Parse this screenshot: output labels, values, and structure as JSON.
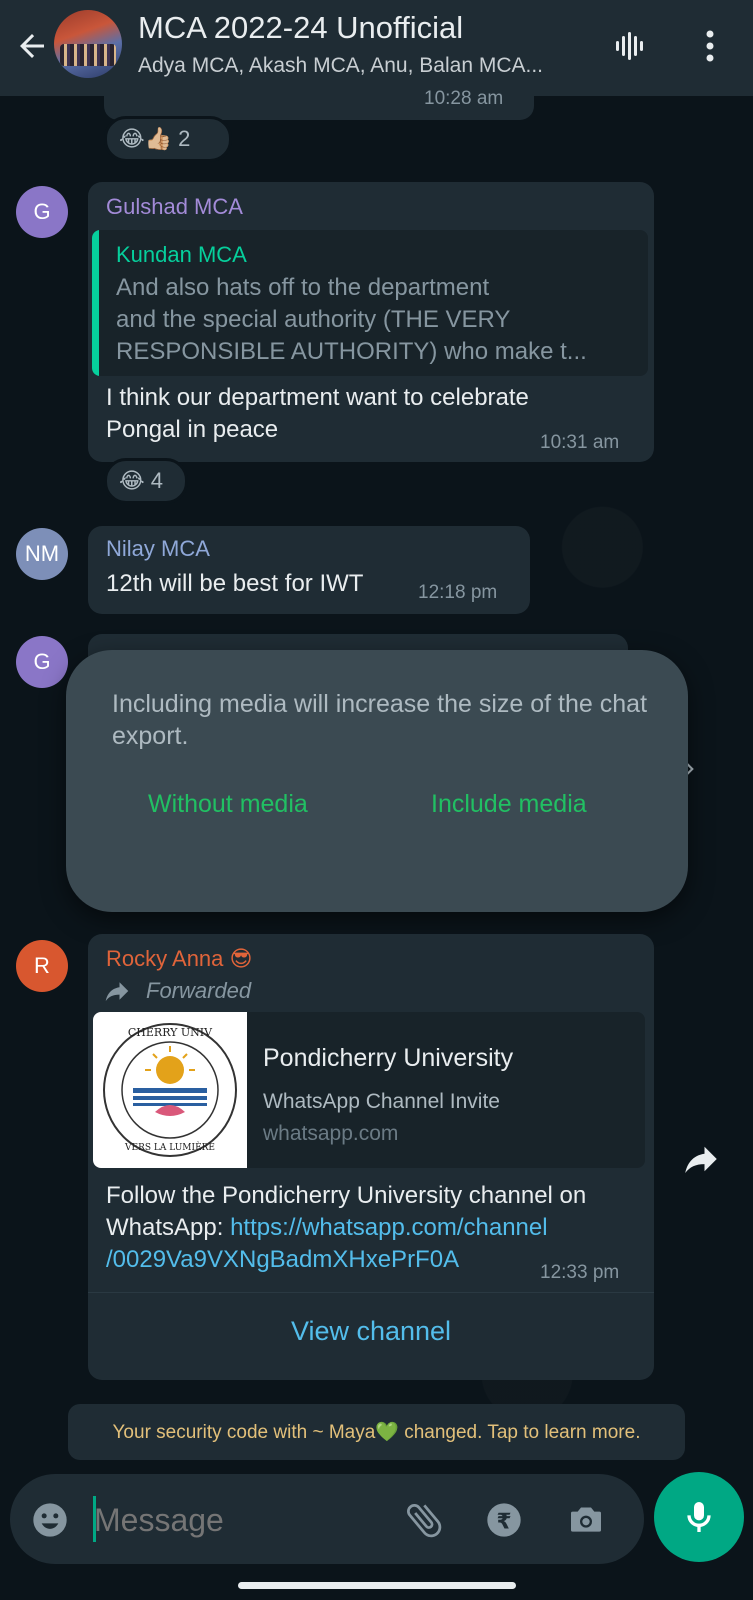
{
  "header": {
    "title": "MCA 2022-24 Unofficial",
    "subtitle": "Adya MCA, Akash MCA, Anu, Balan MCA..."
  },
  "messages": [
    {
      "time_partial": "10:28 am",
      "reaction_emojis": "😂👍🏼",
      "reaction_count": "2"
    },
    {
      "avatar_initial": "G",
      "sender": "Gulshad MCA",
      "sender_color": "#a38bd8",
      "quote_sender": "Kundan MCA",
      "quote_text_line1": "And also hats off to the department",
      "quote_text_line2": "and the special authority (THE VERY",
      "quote_text_line3": "RESPONSIBLE AUTHORITY) who make t...",
      "text_line1": "I think our department want to celebrate",
      "text_line2": "Pongal in peace",
      "time": "10:31 am",
      "reaction_emojis": "😂",
      "reaction_count": "4"
    },
    {
      "avatar_initial": "NM",
      "sender": "Nilay MCA",
      "sender_color": "#8fa8d8",
      "text": "12th will be best for IWT",
      "time": "12:18 pm"
    },
    {
      "avatar_initial": "G"
    },
    {
      "avatar_initial": "R",
      "sender": "Rocky Anna 😎",
      "sender_color": "#e0643a",
      "forwarded": "Forwarded",
      "preview_title": "Pondicherry University",
      "preview_subtitle": "WhatsApp Channel Invite",
      "preview_domain": "whatsapp.com",
      "text_line1": "Follow the Pondicherry University channel on",
      "text_line2_prefix": "WhatsApp: ",
      "link_line1": "https://whatsapp.com/channel",
      "link_line2": "/0029Va9VXNgBadmXHxePrF0A",
      "time": "12:33 pm",
      "action": "View channel"
    }
  ],
  "dialog": {
    "message": "Including media will increase the size of the chat export.",
    "button_without": "Without media",
    "button_include": "Include media"
  },
  "system_message": "Your security code with ~ Maya💚 changed. Tap to learn more.",
  "input": {
    "placeholder": "Message"
  },
  "colors": {
    "accent": "#00a884",
    "background": "#0b141a",
    "bubble": "#1f2c34",
    "dialog": "#3b4a52"
  }
}
